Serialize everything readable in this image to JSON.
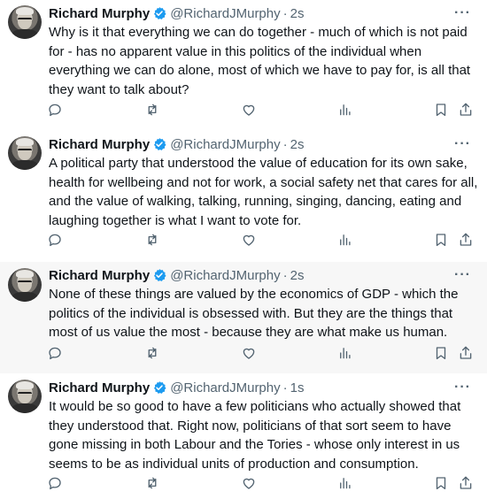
{
  "tweets": [
    {
      "author_name": "Richard Murphy",
      "handle": "@RichardJMurphy",
      "separator": "·",
      "time": "2s",
      "text": "Why is it that everything we can do together - much of which is not paid for - has no apparent value in this politics of the individual when everything we can do alone, most of which we have to pay for, is all that they want to talk about?"
    },
    {
      "author_name": "Richard Murphy",
      "handle": "@RichardJMurphy",
      "separator": "·",
      "time": "2s",
      "text": "A political party that understood the value of education for its own sake, health for wellbeing and not for work, a social safety net that cares for all, and the value of walking, talking, running, singing, dancing, eating and laughing together is what I want to vote for."
    },
    {
      "author_name": "Richard Murphy",
      "handle": "@RichardJMurphy",
      "separator": "·",
      "time": "2s",
      "text": "None of these things are valued by the economics of GDP - which the politics of the individual is obsessed with. But they are the things that most of us value the most - because they are what make us human."
    },
    {
      "author_name": "Richard Murphy",
      "handle": "@RichardJMurphy",
      "separator": "·",
      "time": "1s",
      "text": "It would be so good to have a few politicians who actually showed that they understood that. Right now,  politicians of that sort seem to have gone missing in both Labour and the Tories - whose only interest in us seems to be as individual units of production and consumption."
    }
  ],
  "more_label": "···",
  "icons": [
    "reply-icon",
    "retweet-icon",
    "like-icon",
    "views-icon",
    "bookmark-icon",
    "share-icon"
  ],
  "colors": {
    "verified": "#1d9bf0",
    "muted": "#536471",
    "text": "#0f1419"
  }
}
